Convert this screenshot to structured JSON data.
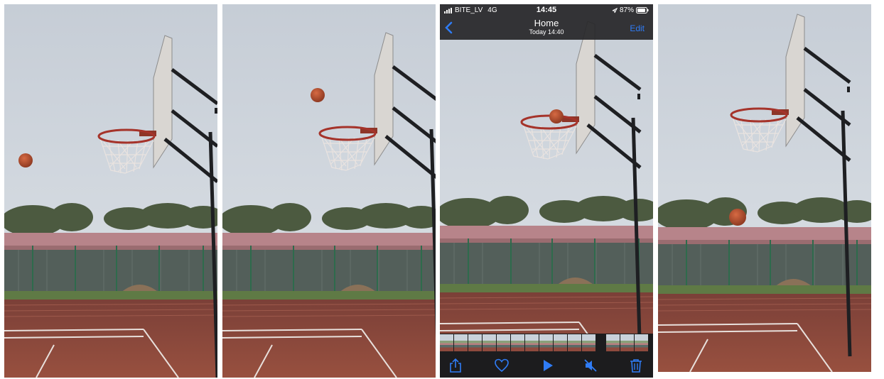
{
  "status_bar": {
    "carrier": "BITE_LV",
    "network": "4G",
    "time": "14:45",
    "battery": "87%"
  },
  "nav": {
    "title": "Home",
    "subtitle": "Today  14:40",
    "edit_label": "Edit"
  },
  "toolbar": {
    "icons": [
      "share-icon",
      "heart-icon",
      "play-icon",
      "mute-icon",
      "trash-icon"
    ]
  },
  "colors": {
    "ios_accent": "#2f7cf6",
    "ball": "#b84e2e",
    "court": "#8e4a3e"
  }
}
